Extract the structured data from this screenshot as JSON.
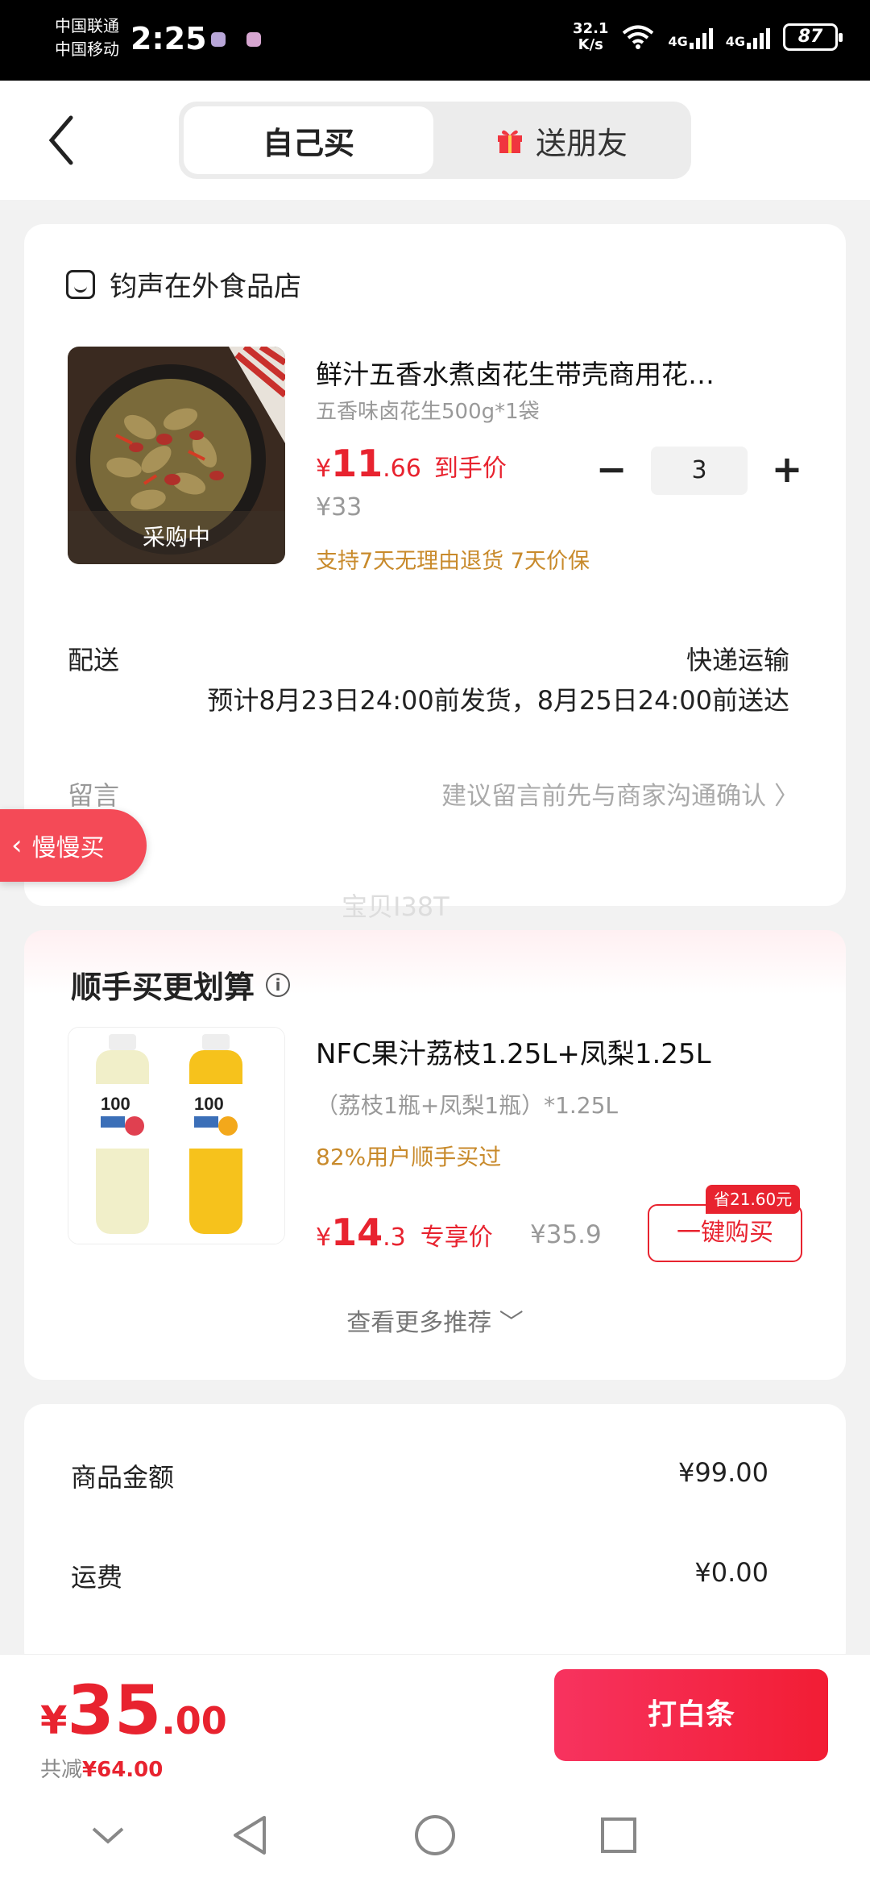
{
  "status_bar": {
    "carrier1": "中国联通",
    "carrier2": "中国移动",
    "time": "2:25",
    "net_speed": "32.1",
    "net_unit": "K/s",
    "sig1": "4G",
    "sig2": "4G",
    "battery": "87"
  },
  "header": {
    "tabs": [
      {
        "label": "自己买",
        "active": true
      },
      {
        "label": "送朋友",
        "active": false
      }
    ]
  },
  "order": {
    "shop_name": "钧声在外食品店",
    "product": {
      "title": "鲜汁五香水煮卤花生带壳商用花…",
      "spec": "五香味卤花生500g*1袋",
      "price_currency": "¥",
      "price_int": "11",
      "price_dec": ".66",
      "price_label": "到手价",
      "original_price": "¥33",
      "thumb_status": "采购中",
      "guarantees": "支持7天无理由退货  7天价保",
      "quantity": "3"
    },
    "delivery": {
      "label": "配送",
      "method": "快递运输",
      "note": "预计8月23日24:00前发货，8月25日24:00前送达"
    },
    "message": {
      "label": "留言",
      "placeholder": "建议留言前先与商家沟通确认 〉"
    }
  },
  "floating": {
    "slow_buy": "慢慢买",
    "watermark": "宝贝I38T"
  },
  "recommend": {
    "title": "顺手买更划算",
    "product": {
      "title": "NFC果汁荔枝1.25L+凤梨1.25L",
      "spec": "（荔枝1瓶+凤梨1瓶）*1.25L",
      "stat": "82%用户顺手买过",
      "price_currency": "¥",
      "price_int": "14",
      "price_dec": ".3",
      "price_label": "专享价",
      "original_price": "¥35.9",
      "save_badge": "省21.60元",
      "buy_label": "一键购买"
    },
    "more_label": "查看更多推荐 ﹀"
  },
  "summary": {
    "rows": [
      {
        "label": "商品金额",
        "value": "¥99.00"
      },
      {
        "label": "运费",
        "value": "¥0.00"
      }
    ]
  },
  "checkout": {
    "currency": "¥",
    "total_int": "35",
    "total_dec": ".00",
    "saved_label": "共减",
    "saved_value": "¥64.00",
    "pay_label": "打白条"
  },
  "colors": {
    "accent": "#e8232f",
    "tag": "#c88a2b",
    "float_btn": "#f44a57"
  }
}
